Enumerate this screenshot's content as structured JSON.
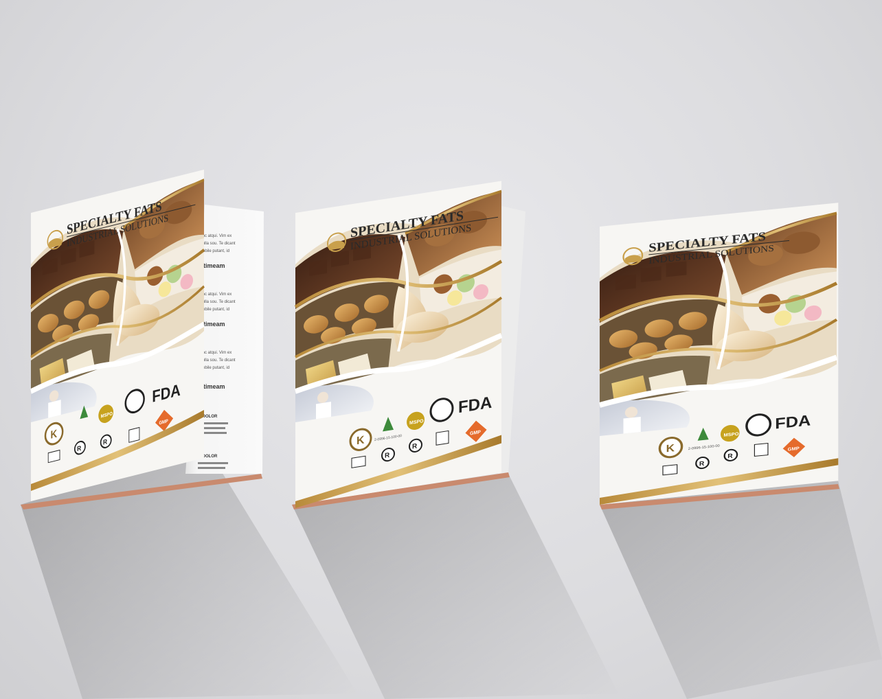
{
  "brochures": [
    {
      "title": "SPECIALTY FATS",
      "subtitle": "INDUSTRIAL SOLUTIONS"
    },
    {
      "title": "SPECIALTY FATS",
      "subtitle": "INDUSTRIAL SOLUTIONS"
    },
    {
      "title": "SPECIALTY FATS",
      "subtitle": "INDUSTRIAL SOLUTIONS"
    }
  ],
  "certifications": {
    "fda": "FDA",
    "mspo": "MSPO",
    "gmp": "GMP",
    "rspo_code": "2-0996-15-100-00",
    "kosher": "K",
    "registered": "R"
  },
  "inner_page": {
    "heading_1": "o timeam",
    "heading_2": "o timeam",
    "heading_3": "o timeam",
    "lines_1": [
      "hinc atqui. Vim ex",
      "igulla sou. Te dicant",
      "mobile putant, id"
    ],
    "lines_2": [
      "hinc atqui. Vim ex",
      "igulla sou. Te dicant",
      "mobile putant, id"
    ],
    "lines_3": [
      "hinc atqui. Vim ex",
      "igulla sou. Te dicant",
      "mobile putant, id"
    ],
    "section_4": "M DOLOR",
    "section_5": "M DOLOR"
  },
  "colors": {
    "gold": "#c9a04c",
    "gold_dark": "#a77c2e",
    "paper": "#f7f6f3",
    "chocolate": "#5a3520",
    "pastry": "#d9a75e"
  }
}
